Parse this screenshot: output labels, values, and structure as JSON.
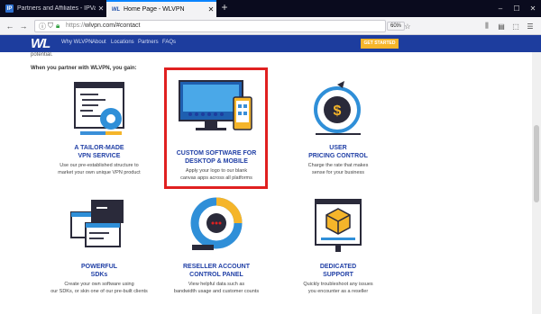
{
  "browser": {
    "tabs": [
      {
        "title": "Partners and Affiliates - IPVani",
        "favicon": "IP"
      },
      {
        "title": "Home Page - WLVPN",
        "favicon": "WL"
      }
    ],
    "new_tab": "+",
    "window_controls": [
      "–",
      "☐",
      "✕"
    ],
    "url_prefix": "https://",
    "url_host": "wlvpn.com/#contact",
    "zoom": "60%",
    "page_actions": "···"
  },
  "site": {
    "logo": "WL",
    "nav": [
      "Why WLVPN",
      "About",
      "Locations",
      "Partners",
      "FAQs"
    ],
    "cta": "GET STARTED"
  },
  "content": {
    "potential": "potential.",
    "partner_intro": "When you partner with WLVPN, you gain:",
    "features": [
      {
        "title_lines": [
          "A TAILOR-MADE",
          "VPN SERVICE"
        ],
        "desc_lines": [
          "Use our pre-established structure to",
          "market your own unique VPN product"
        ],
        "icon": "code-gear-icon"
      },
      {
        "title_lines": [
          "CUSTOM SOFTWARE FOR",
          "DESKTOP & MOBILE"
        ],
        "desc_lines": [
          "Apply your logo to our blank",
          "canvas apps across all platforms"
        ],
        "icon": "monitor-phone-icon"
      },
      {
        "title_lines": [
          "USER",
          "PRICING CONTROL"
        ],
        "desc_lines": [
          "Charge the rate that makes",
          "sense for your business"
        ],
        "icon": "dollar-cycle-icon"
      },
      {
        "title_lines": [
          "POWERFUL",
          "SDKs"
        ],
        "desc_lines": [
          "Create your own software using",
          "our SDKs, or skin one of our pre-built clients"
        ],
        "icon": "sdk-windows-icon"
      },
      {
        "title_lines": [
          "RESELLER ACCOUNT",
          "CONTROL PANEL"
        ],
        "desc_lines": [
          "View helpful data such as",
          "bandwidth usage and customer counts"
        ],
        "icon": "donut-dashboard-icon"
      },
      {
        "title_lines": [
          "DEDICATED",
          "SUPPORT"
        ],
        "desc_lines": [
          "Quickly troubleshoot any issues",
          "you encounter as a reseller"
        ],
        "icon": "support-tools-icon"
      }
    ]
  },
  "colors": {
    "brand_blue": "#1d3d9e",
    "accent_yellow": "#f5b52a",
    "highlight_red": "#e02020"
  }
}
